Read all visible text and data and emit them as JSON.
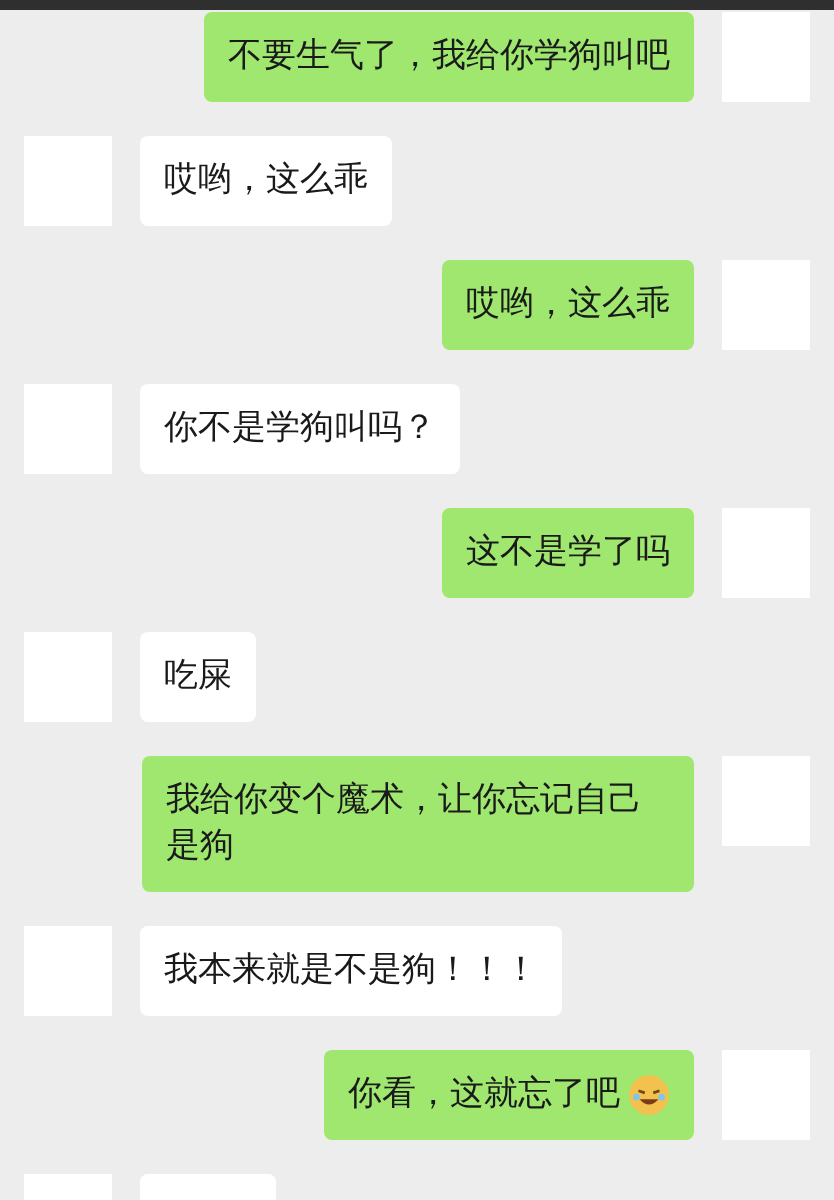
{
  "messages": [
    {
      "kind": "sent",
      "text": "不要生气了，我给你学狗叫吧"
    },
    {
      "kind": "received",
      "text": "哎哟，这么乖"
    },
    {
      "kind": "sent",
      "text": "哎哟，这么乖"
    },
    {
      "kind": "received",
      "text": "你不是学狗叫吗？"
    },
    {
      "kind": "sent",
      "text": "这不是学了吗"
    },
    {
      "kind": "received",
      "text": "吃屎"
    },
    {
      "kind": "sent",
      "text": "我给你变个魔术，让你忘记自己是狗"
    },
    {
      "kind": "received",
      "text": "我本来就是不是狗！！！"
    },
    {
      "kind": "sent",
      "text": "你看，这就忘了吧",
      "emoji": true
    },
    {
      "kind": "received",
      "partial": true
    }
  ]
}
